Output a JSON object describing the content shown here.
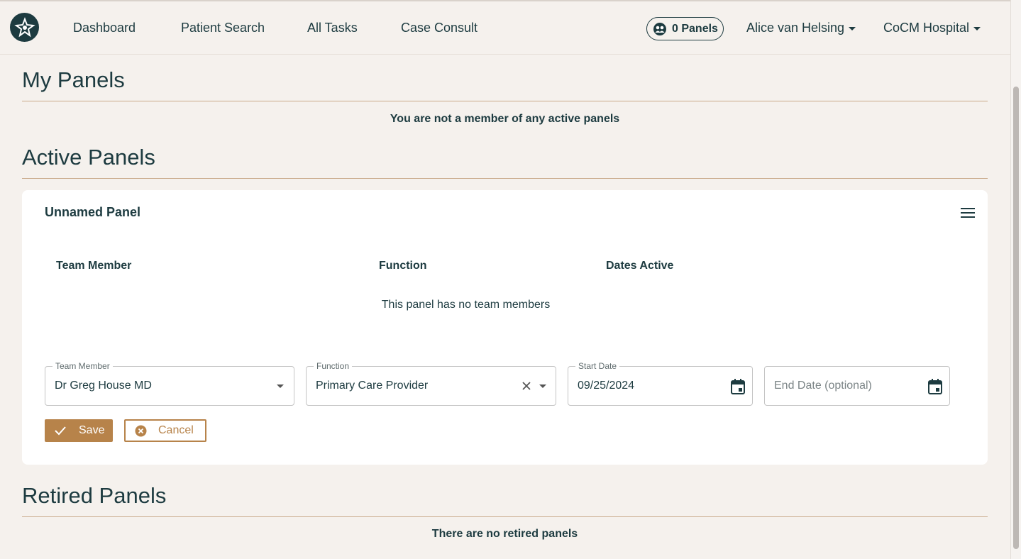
{
  "nav": {
    "links": [
      "Dashboard",
      "Patient Search",
      "All Tasks",
      "Case Consult"
    ],
    "panels_label": "0 Panels",
    "user_name": "Alice van Helsing",
    "hospital_name": "CoCM Hospital"
  },
  "my_panels": {
    "title": "My Panels",
    "message": "You are not a member of any active panels"
  },
  "active_panels": {
    "title": "Active Panels",
    "panel": {
      "name": "Unnamed Panel",
      "columns": [
        "Team Member",
        "Function",
        "Dates Active"
      ],
      "empty_message": "This panel has no team members",
      "form": {
        "team_member_label": "Team Member",
        "team_member_value": "Dr Greg House MD",
        "function_label": "Function",
        "function_value": "Primary Care Provider",
        "start_date_label": "Start Date",
        "start_date_value": "09/25/2024",
        "end_date_placeholder": "End Date (optional)",
        "save_label": "Save",
        "cancel_label": "Cancel"
      }
    }
  },
  "retired_panels": {
    "title": "Retired Panels",
    "message": "There are no retired panels"
  },
  "colors": {
    "primary": "#1d3b40",
    "accent": "#b7834a",
    "background": "#f5f1ed",
    "rule": "#c9a98a"
  },
  "icons": [
    "logo-icon",
    "group-icon",
    "menu-icon",
    "clear-icon",
    "calendar-icon",
    "check-icon",
    "cancel-circle-icon"
  ]
}
